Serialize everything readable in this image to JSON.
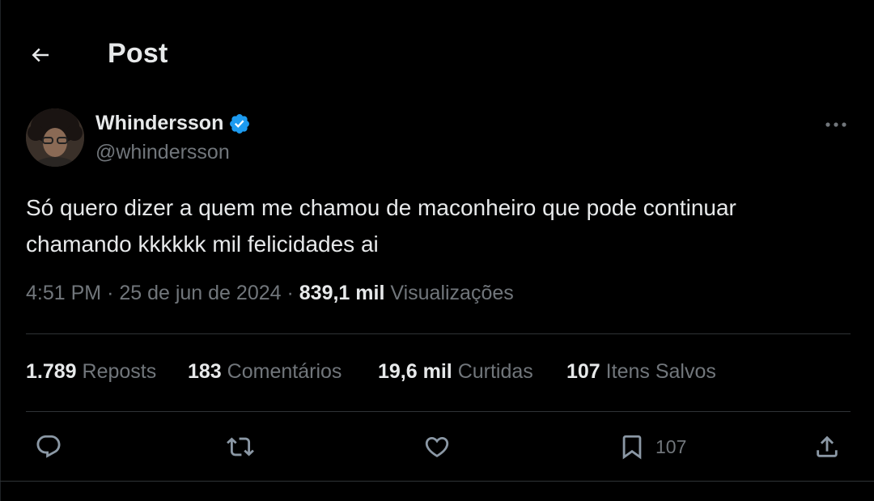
{
  "header": {
    "back_icon": "arrow-left-icon",
    "title": "Post"
  },
  "author": {
    "name": "Whindersson",
    "handle": "@whindersson",
    "verified_icon": "verified-badge-icon",
    "verified_color": "#1d9bf0"
  },
  "post": {
    "text": "Só quero dizer a quem me chamou de maconheiro que pode continuar chamando kkkkkk mil felicidades ai",
    "time": "4:51 PM",
    "separator": "·",
    "date": "25 de jun de 2024",
    "views_count": "839,1 mil",
    "views_label": "Visualizações"
  },
  "stats": [
    {
      "count": "1.789",
      "label": "Reposts"
    },
    {
      "count": "183",
      "label": "Comentários"
    },
    {
      "count": "19,6 mil",
      "label": "Curtidas"
    },
    {
      "count": "107",
      "label": "Itens Salvos"
    }
  ],
  "actions": {
    "reply_icon": "reply-icon",
    "repost_icon": "repost-icon",
    "like_icon": "heart-icon",
    "bookmark_icon": "bookmark-icon",
    "bookmark_count": "107",
    "share_icon": "share-icon"
  },
  "colors": {
    "background": "#000000",
    "text_primary": "#e7e9ea",
    "text_secondary": "#71767b",
    "divider": "#2f3336"
  }
}
